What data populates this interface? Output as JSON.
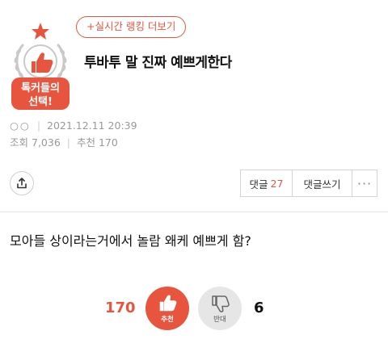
{
  "badge": {
    "line1": "톡커들의",
    "line2": "선택!"
  },
  "header": {
    "ranking_link": "+실시간 랭킹 더보기",
    "title": "투바투 말 진짜 예쁘게한다"
  },
  "meta": {
    "author": "○○",
    "date": "2021.12.11 20:39",
    "views_label": "조회",
    "views": "7,036",
    "recommend_label": "추천",
    "recommend": "170"
  },
  "actions": {
    "comments_label": "댓글",
    "comments_count": "27",
    "write_comment_label": "댓글쓰기",
    "more_label": "···"
  },
  "post": {
    "body": "모아들 상이라는거에서 놀람 왜케 예쁘게 함?"
  },
  "vote": {
    "up_count": "170",
    "up_label": "추천",
    "down_label": "반대",
    "down_count": "6"
  },
  "colors": {
    "accent": "#e8553f",
    "muted": "#999999",
    "vote_down_bg": "#e6e6e6"
  }
}
